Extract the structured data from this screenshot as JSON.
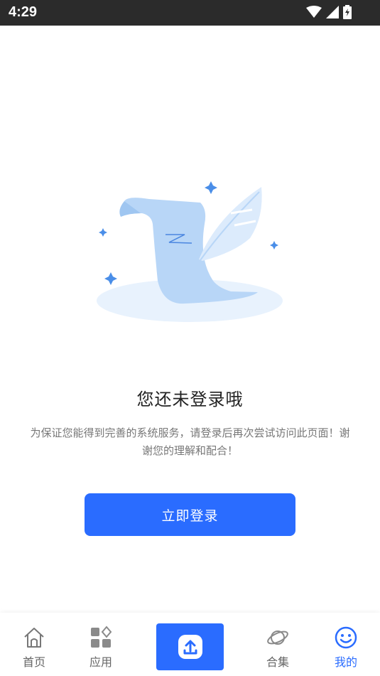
{
  "status_bar": {
    "time": "4:29"
  },
  "empty_state": {
    "title": "您还未登录哦",
    "description": "为保证您能得到完善的系统服务，请登录后再次尝试访问此页面！谢\n谢您的理解和配合！",
    "login_label": "立即登录"
  },
  "tab_bar": {
    "home_label": "首页",
    "apps_label": "应用",
    "collection_label": "合集",
    "me_label": "我的"
  },
  "colors": {
    "accent": "#2a6cff"
  }
}
